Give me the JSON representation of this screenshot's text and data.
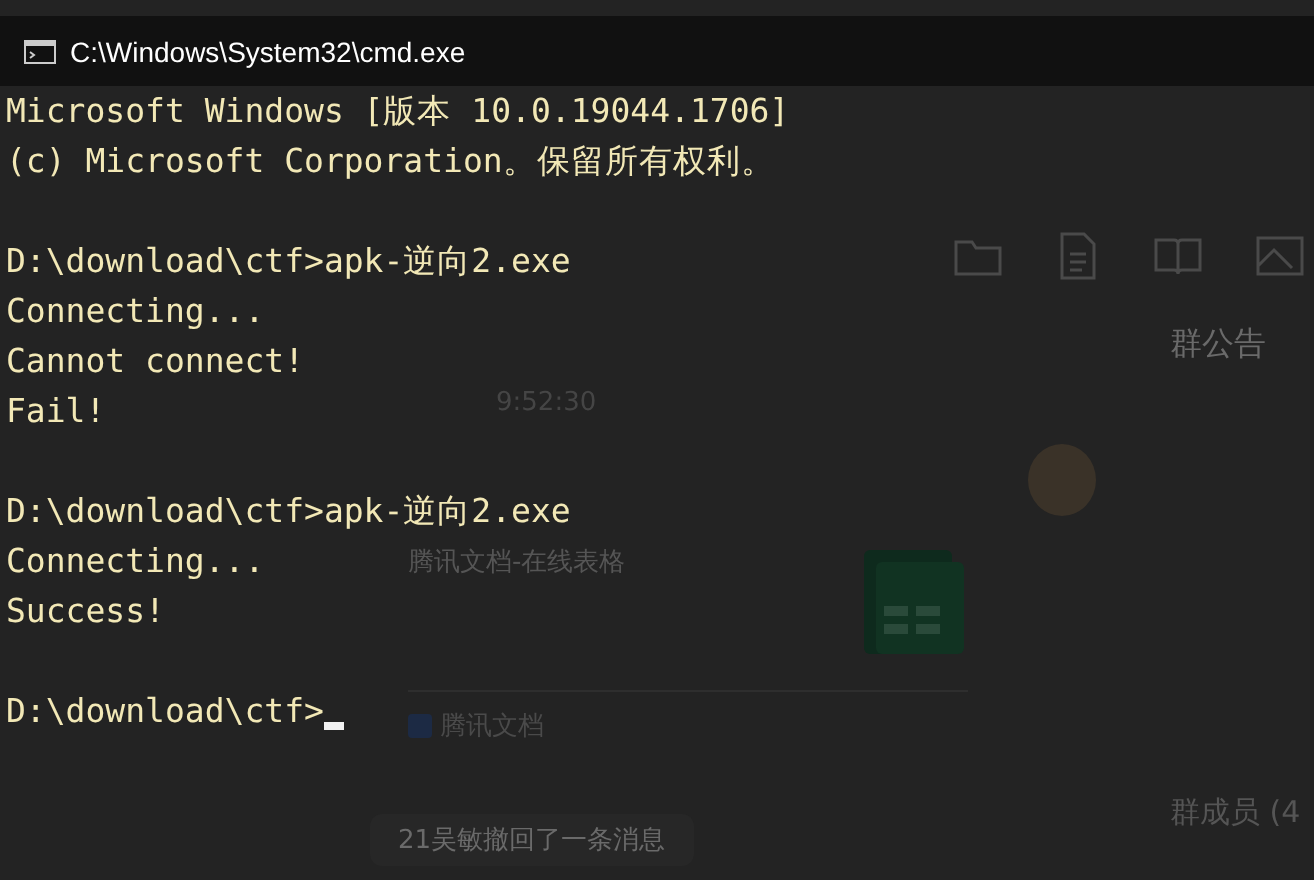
{
  "window": {
    "title": "C:\\Windows\\System32\\cmd.exe"
  },
  "console": {
    "lines": [
      {
        "kind": "text",
        "text": "Microsoft Windows [版本 10.0.19044.1706]"
      },
      {
        "kind": "text",
        "text": "(c) Microsoft Corporation。保留所有权利。"
      },
      {
        "kind": "blank"
      },
      {
        "kind": "text",
        "text": "D:\\download\\ctf>apk-逆向2.exe"
      },
      {
        "kind": "text",
        "text": "Connecting..."
      },
      {
        "kind": "text",
        "text": "Cannot connect!"
      },
      {
        "kind": "text",
        "text": "Fail!"
      },
      {
        "kind": "blank"
      },
      {
        "kind": "text",
        "text": "D:\\download\\ctf>apk-逆向2.exe"
      },
      {
        "kind": "text",
        "text": "Connecting..."
      },
      {
        "kind": "text",
        "text": "Success!"
      },
      {
        "kind": "blank"
      },
      {
        "kind": "prompt",
        "text": "D:\\download\\ctf>"
      }
    ]
  },
  "background_app": {
    "announcement": "群公告",
    "time": "9:52:30",
    "card": {
      "subtitle": "腾讯文档-在线表格",
      "source": "腾讯文档"
    },
    "recall_notice": "21吴敏撤回了一条消息",
    "members": "群成员 (4"
  }
}
